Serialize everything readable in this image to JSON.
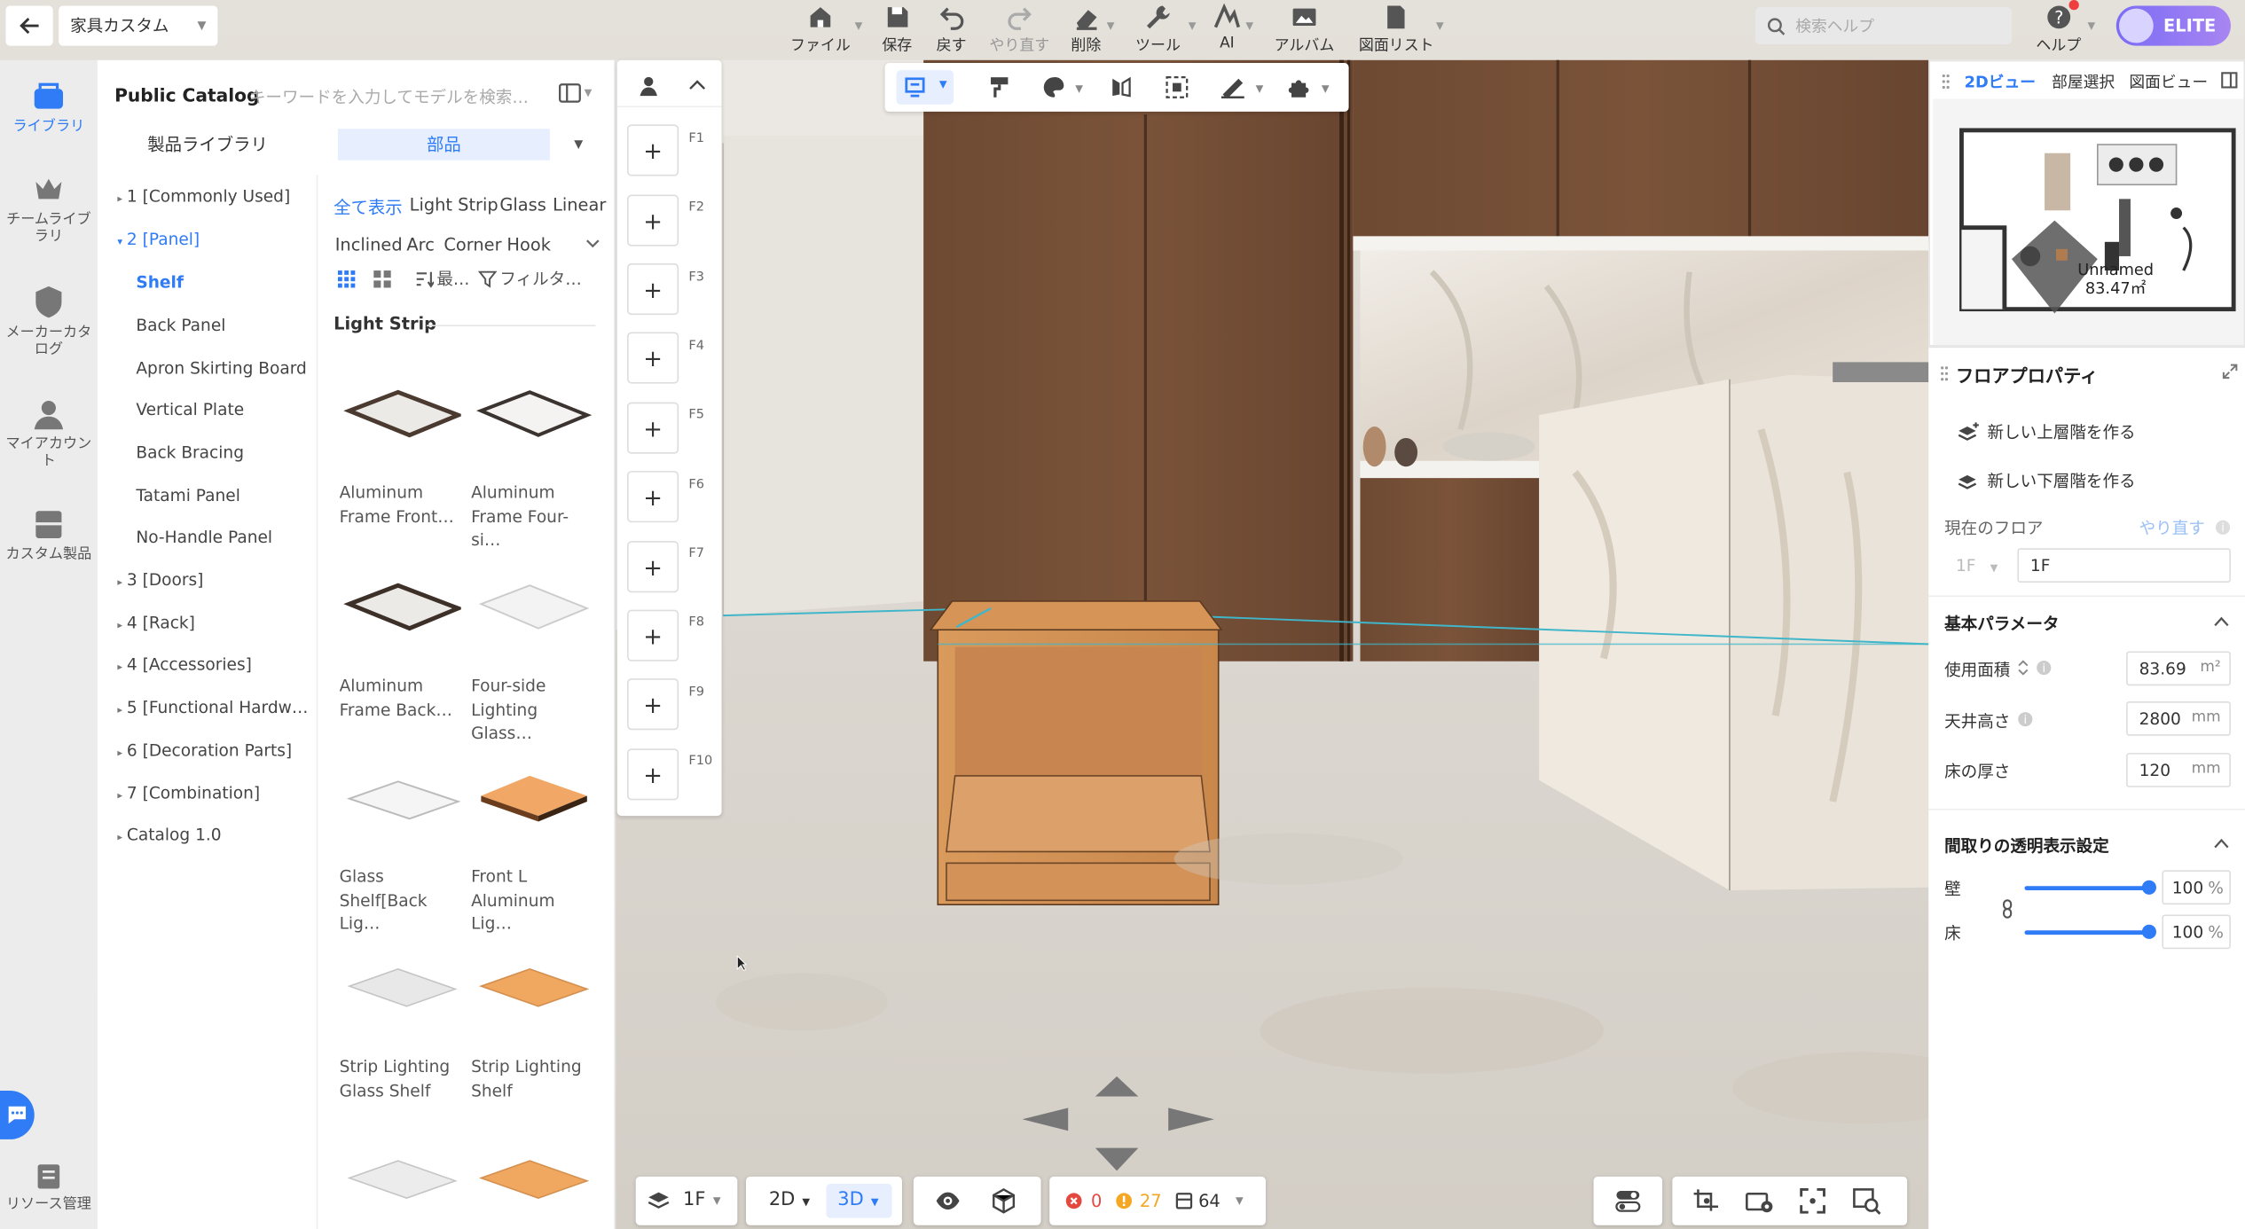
{
  "app": {
    "project_name": "家具カスタム",
    "plan_badge": "ELITE"
  },
  "topbar": {
    "menu": [
      {
        "label": "ファイル",
        "icon": "home-icon"
      },
      {
        "label": "保存",
        "icon": "save-icon"
      },
      {
        "label": "戻す",
        "icon": "undo-icon"
      },
      {
        "label": "やり直す",
        "icon": "redo-icon",
        "disabled": true
      },
      {
        "label": "削除",
        "icon": "eraser-icon"
      },
      {
        "label": "ツール",
        "icon": "wrench-icon"
      },
      {
        "label": "AI",
        "icon": "ai-icon"
      },
      {
        "label": "アルバム",
        "icon": "album-icon"
      },
      {
        "label": "図面リスト",
        "icon": "document-icon"
      }
    ],
    "search_placeholder": "検索ヘルプ",
    "help_label": "ヘルプ"
  },
  "rail": {
    "items": [
      {
        "label": "ライブラリ",
        "active": true
      },
      {
        "label": "チームライブラリ"
      },
      {
        "label": "メーカーカタログ"
      },
      {
        "label": "マイアカウント"
      },
      {
        "label": "カスタム製品"
      }
    ],
    "bottom_label": "リソース管理"
  },
  "catalog": {
    "title": "Public Catalog",
    "search_placeholder": "キーワードを入力してモデルを検索…",
    "tabs": [
      "製品ライブラリ",
      "部品"
    ],
    "active_tab": 1,
    "tree": [
      {
        "label": "1 [Commonly Used]",
        "type": "collapsed"
      },
      {
        "label": "2 [Panel]",
        "type": "expanded"
      },
      {
        "label": "Shelf",
        "type": "active-child"
      },
      {
        "label": "Back Panel",
        "type": "child"
      },
      {
        "label": "Apron Skirting Board",
        "type": "child"
      },
      {
        "label": "Vertical Plate",
        "type": "child"
      },
      {
        "label": "Back Bracing",
        "type": "child"
      },
      {
        "label": "Tatami Panel",
        "type": "child"
      },
      {
        "label": "No-Handle Panel",
        "type": "child"
      },
      {
        "label": "3 [Doors]",
        "type": "collapsed"
      },
      {
        "label": "4 [Rack]",
        "type": "collapsed"
      },
      {
        "label": "4 [Accessories]",
        "type": "collapsed"
      },
      {
        "label": "5 [Functional Hardw…",
        "type": "collapsed"
      },
      {
        "label": "6 [Decoration Parts]",
        "type": "collapsed"
      },
      {
        "label": "7 [Combination]",
        "type": "collapsed"
      },
      {
        "label": "Catalog 1.0",
        "type": "collapsed"
      }
    ],
    "filters_row1": [
      "全て表示",
      "Light Strip",
      "Glass",
      "Linear"
    ],
    "filters_row2": [
      "Inclined",
      "Arc",
      "Corner",
      "Hook"
    ],
    "sort_label": "最…",
    "filter_label": "フィルタ…",
    "section_title": "Light Strip",
    "items": [
      {
        "line1": "Aluminum",
        "line2": "Frame Front…",
        "thumb": "dark-frame"
      },
      {
        "line1": "Aluminum",
        "line2": "Frame Four-si…",
        "thumb": "dark-frame"
      },
      {
        "line1": "Aluminum",
        "line2": "Frame Back…",
        "thumb": "dark-frame"
      },
      {
        "line1": "Four-side",
        "line2": "Lighting Glass…",
        "thumb": "glass"
      },
      {
        "line1": "Glass",
        "line2": "Shelf[Back Lig…",
        "thumb": "glass"
      },
      {
        "line1": "Front L",
        "line2": "Aluminum Lig…",
        "thumb": "wood"
      },
      {
        "line1": "Strip Lighting",
        "line2": "Glass Shelf",
        "thumb": "glass"
      },
      {
        "line1": "Strip Lighting",
        "line2": "Shelf",
        "thumb": "wood"
      },
      {
        "line1": "",
        "line2": "",
        "thumb": "glass"
      },
      {
        "line1": "",
        "line2": "",
        "thumb": "wood"
      }
    ]
  },
  "floors": [
    "F1",
    "F2",
    "F3",
    "F4",
    "F5",
    "F6",
    "F7",
    "F8",
    "F9",
    "F10"
  ],
  "minimap": {
    "tabs": [
      "2Dビュー",
      "部屋選択",
      "図面ビュー"
    ],
    "active_tab": 0,
    "room_name": "Unnamed",
    "room_area": "83.47㎡"
  },
  "floor_props": {
    "title": "フロアプロパティ",
    "add_upper": "新しい上層階を作る",
    "add_lower": "新しい下層階を作る",
    "current_floor_label": "現在のフロア",
    "redo_label": "やり直す",
    "floor_select": "1F",
    "floor_name": "1F",
    "basic_title": "基本パラメータ",
    "params": [
      {
        "label": "使用面積",
        "value": "83.69",
        "unit": "m²"
      },
      {
        "label": "天井高さ",
        "value": "2800",
        "unit": "mm"
      },
      {
        "label": "床の厚さ",
        "value": "120",
        "unit": "mm"
      }
    ],
    "transparency_title": "間取りの透明表示設定",
    "wall_label": "壁",
    "wall_value": "100",
    "floor_label": "床",
    "floor_value": "100",
    "pct": "%"
  },
  "bottombar": {
    "floor": "1F",
    "mode_2d": "2D",
    "mode_3d": "3D",
    "errors": "0",
    "warnings": "27",
    "items": "64"
  }
}
